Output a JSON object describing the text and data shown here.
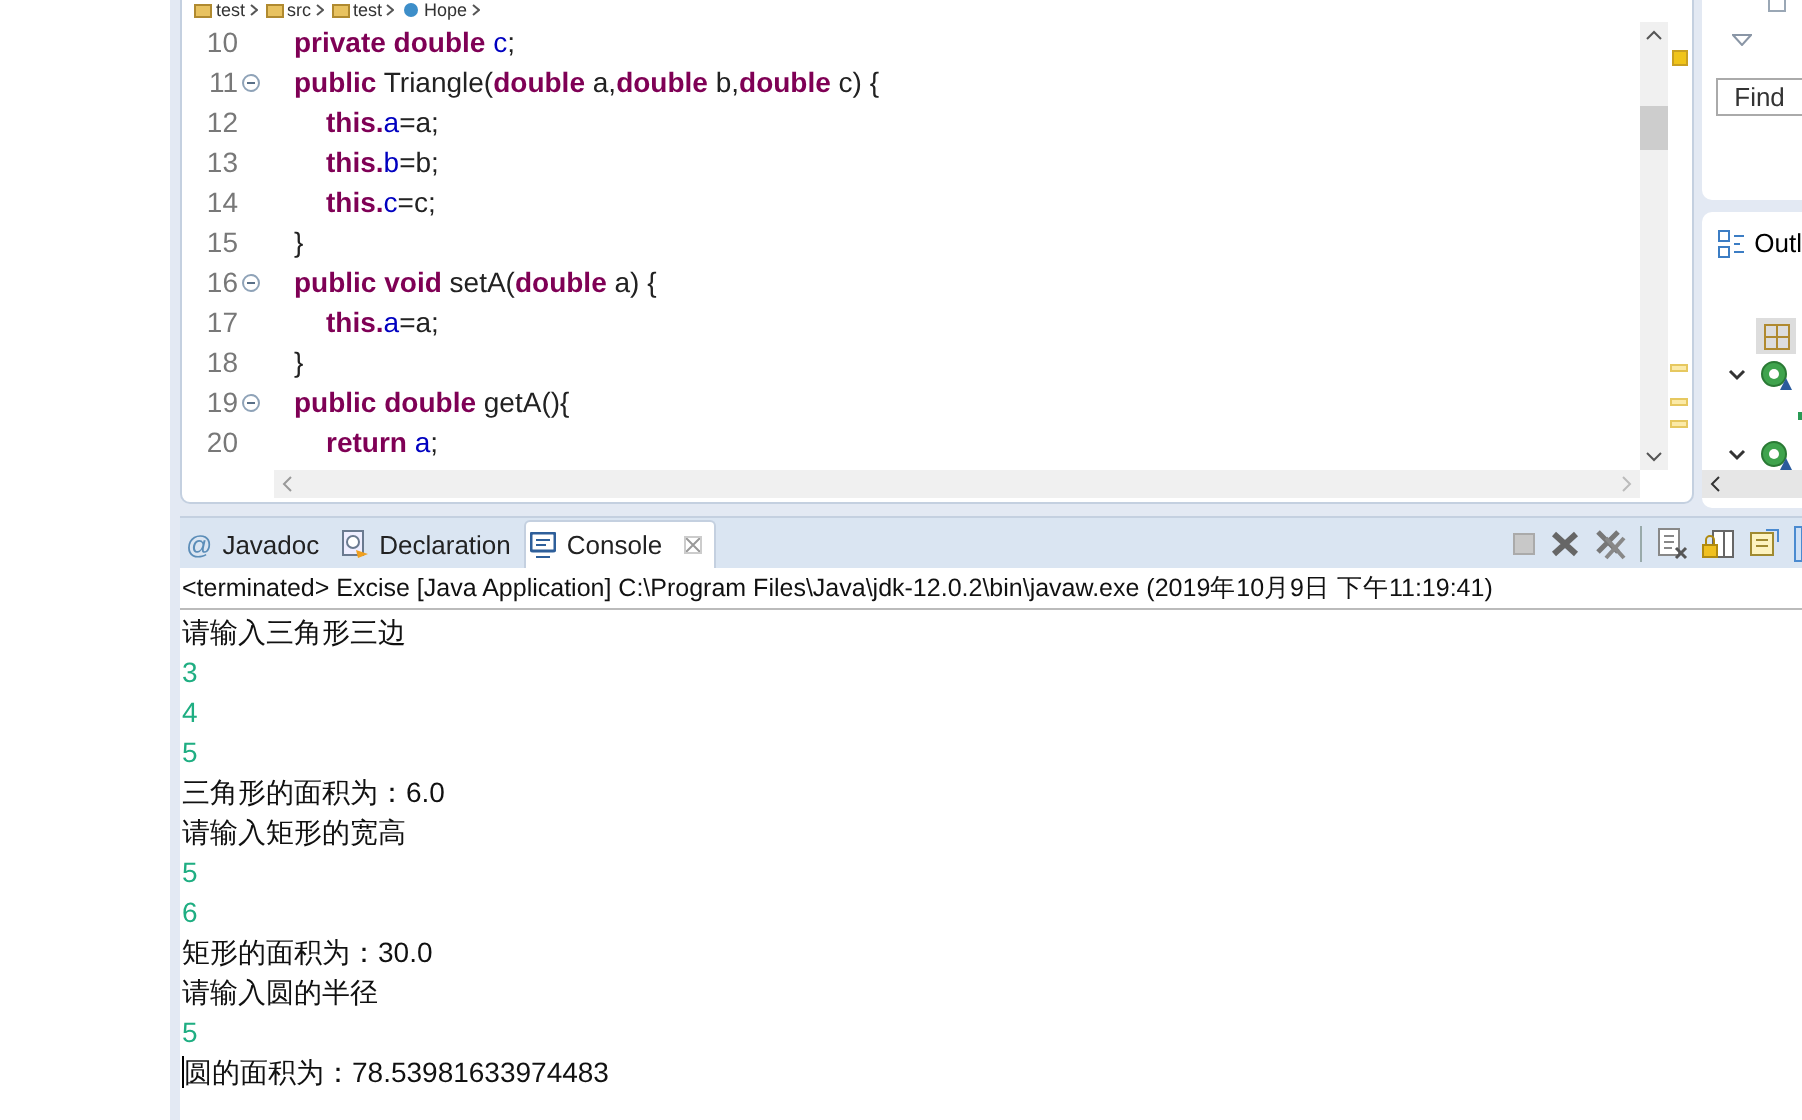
{
  "breadcrumb": [
    "test",
    "src",
    "test",
    "Hope"
  ],
  "editor": {
    "lines": [
      {
        "number": "10",
        "kind": "member",
        "foldable": false,
        "tokens": [
          {
            "kind": "keyword",
            "text": "private double "
          },
          {
            "kind": "field",
            "text": "c"
          },
          {
            "kind": "plain",
            "text": ";"
          }
        ]
      },
      {
        "number": "11",
        "kind": "member",
        "foldable": true,
        "tokens": [
          {
            "kind": "keyword",
            "text": "public"
          },
          {
            "kind": "plain",
            "text": " Triangle("
          },
          {
            "kind": "keyword",
            "text": "double"
          },
          {
            "kind": "plain",
            "text": " a,"
          },
          {
            "kind": "keyword",
            "text": "double"
          },
          {
            "kind": "plain",
            "text": " b,"
          },
          {
            "kind": "keyword",
            "text": "double"
          },
          {
            "kind": "plain",
            "text": " c) {"
          }
        ]
      },
      {
        "number": "12",
        "kind": "statement",
        "foldable": false,
        "tokens": [
          {
            "kind": "keyword",
            "text": "this."
          },
          {
            "kind": "field",
            "text": "a"
          },
          {
            "kind": "plain",
            "text": "=a;"
          }
        ]
      },
      {
        "number": "13",
        "kind": "statement",
        "foldable": false,
        "tokens": [
          {
            "kind": "keyword",
            "text": "this."
          },
          {
            "kind": "field",
            "text": "b"
          },
          {
            "kind": "plain",
            "text": "=b;"
          }
        ]
      },
      {
        "number": "14",
        "kind": "statement",
        "foldable": false,
        "tokens": [
          {
            "kind": "keyword",
            "text": "this."
          },
          {
            "kind": "field",
            "text": "c"
          },
          {
            "kind": "plain",
            "text": "=c;"
          }
        ]
      },
      {
        "number": "15",
        "kind": "member",
        "foldable": false,
        "tokens": [
          {
            "kind": "plain",
            "text": "}"
          }
        ]
      },
      {
        "number": "16",
        "kind": "member",
        "foldable": true,
        "tokens": [
          {
            "kind": "keyword",
            "text": "public void"
          },
          {
            "kind": "plain",
            "text": " setA("
          },
          {
            "kind": "keyword",
            "text": "double"
          },
          {
            "kind": "plain",
            "text": " a) {"
          }
        ]
      },
      {
        "number": "17",
        "kind": "statement",
        "foldable": false,
        "tokens": [
          {
            "kind": "keyword",
            "text": "this."
          },
          {
            "kind": "field",
            "text": "a"
          },
          {
            "kind": "plain",
            "text": "=a;"
          }
        ]
      },
      {
        "number": "18",
        "kind": "member",
        "foldable": false,
        "tokens": [
          {
            "kind": "plain",
            "text": "}"
          }
        ]
      },
      {
        "number": "19",
        "kind": "member",
        "foldable": true,
        "tokens": [
          {
            "kind": "keyword",
            "text": "public double"
          },
          {
            "kind": "plain",
            "text": " getA(){"
          }
        ]
      },
      {
        "number": "20",
        "kind": "statement",
        "foldable": false,
        "tokens": [
          {
            "kind": "keyword",
            "text": "return "
          },
          {
            "kind": "field",
            "text": "a"
          },
          {
            "kind": "plain",
            "text": ";"
          }
        ]
      }
    ]
  },
  "side_panel": {
    "find": {
      "placeholder": "Find"
    },
    "outline": {
      "title": "Outl",
      "tree": [
        {
          "expanded": true
        },
        {
          "expanded": true
        }
      ]
    }
  },
  "console": {
    "tabs": [
      {
        "kind": "javadoc",
        "icon": "@",
        "label": "Javadoc",
        "selected": false
      },
      {
        "kind": "declaration",
        "label": "Declaration",
        "selected": false
      },
      {
        "kind": "console",
        "label": "Console",
        "selected": true
      }
    ],
    "status": "<terminated> Excise [Java Application] C:\\Program Files\\Java\\jdk-12.0.2\\bin\\javaw.exe (2019年10月9日 下午11:19:41)",
    "output": [
      {
        "kind": "output",
        "text": "请输入三角形三边"
      },
      {
        "kind": "input",
        "text": "3"
      },
      {
        "kind": "input",
        "text": "4"
      },
      {
        "kind": "input",
        "text": "5"
      },
      {
        "kind": "output",
        "text": "三角形的面积为：6.0"
      },
      {
        "kind": "output",
        "text": "请输入矩形的宽高"
      },
      {
        "kind": "input",
        "text": "5"
      },
      {
        "kind": "input",
        "text": "6"
      },
      {
        "kind": "output",
        "text": "矩形的面积为：30.0"
      },
      {
        "kind": "output",
        "text": "请输入圆的半径"
      },
      {
        "kind": "input",
        "text": "5"
      },
      {
        "kind": "output",
        "text": "圆的面积为：78.53981633974483"
      }
    ]
  }
}
